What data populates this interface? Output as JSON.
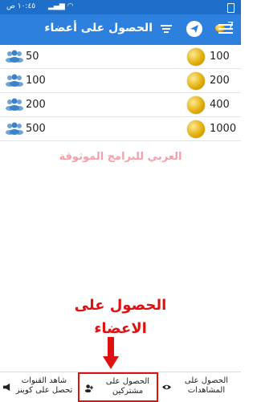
{
  "status_bar": {
    "time": "١٠:٤٥ ص"
  },
  "header": {
    "title": "الحصول على أعضاء",
    "coins": "7"
  },
  "offers": [
    {
      "members": "50",
      "price": "100"
    },
    {
      "members": "100",
      "price": "200"
    },
    {
      "members": "200",
      "price": "400"
    },
    {
      "members": "500",
      "price": "1000"
    }
  ],
  "watermark": "العربي للبرامج الموثوقة",
  "annotation": {
    "line1": "الحصول على",
    "line2": "الاعضاء"
  },
  "bottom_nav": [
    {
      "label": "شاهد القنوات تحصل على كوينز"
    },
    {
      "label": "الحصول على مشتركين"
    },
    {
      "label": "الحصول على المشاهدات"
    }
  ],
  "colors": {
    "accent": "#2d80de",
    "highlight": "#e01010"
  }
}
